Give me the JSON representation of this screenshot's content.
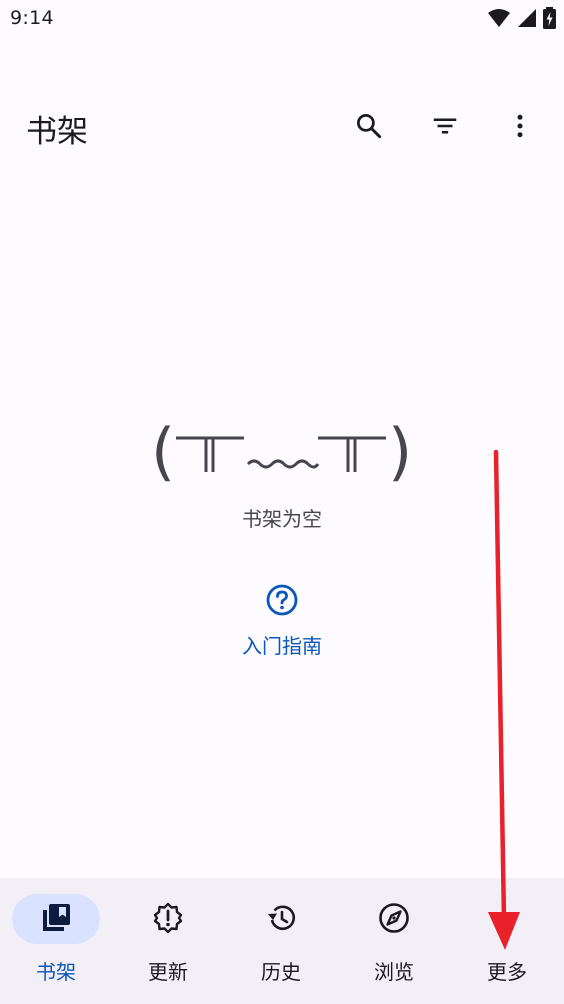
{
  "status_bar": {
    "time": "9:14",
    "icons": [
      "wifi-icon",
      "cellular-signal-icon",
      "battery-charging-icon"
    ]
  },
  "app_bar": {
    "title": "书架",
    "actions": [
      "search-icon",
      "filter-icon",
      "more-vert-icon"
    ]
  },
  "empty_state": {
    "face_left": "(",
    "face_right": ")",
    "message": "书架为空",
    "guide_label": "入门指南",
    "guide_icon": "help-circle-icon"
  },
  "bottom_nav": {
    "items": [
      {
        "label": "书架",
        "icon": "library-icon",
        "active": true
      },
      {
        "label": "更新",
        "icon": "updates-alert-icon",
        "active": false
      },
      {
        "label": "历史",
        "icon": "history-icon",
        "active": false
      },
      {
        "label": "浏览",
        "icon": "compass-icon",
        "active": false
      },
      {
        "label": "更多",
        "icon": "more-icon",
        "active": false
      }
    ]
  },
  "colors": {
    "background": "#FDFBFF",
    "accent": "#0B57B8",
    "active_pill": "#D9E2FF",
    "nav_background": "#F3EFF6",
    "annotation": "#E8212B"
  }
}
